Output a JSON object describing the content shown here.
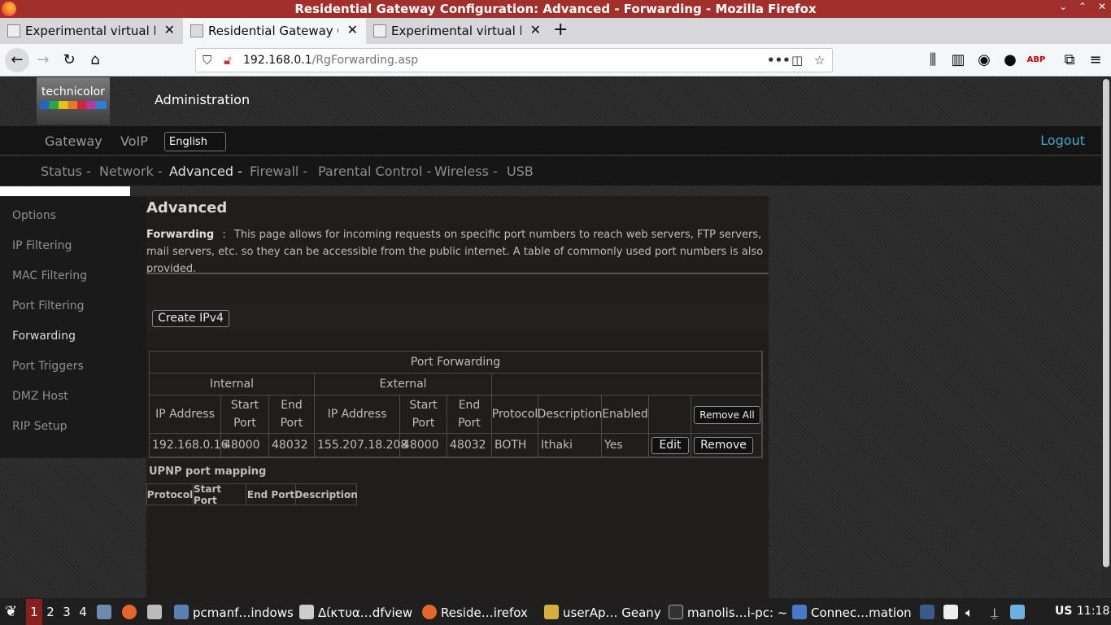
{
  "window": {
    "title": "Residential Gateway Configuration: Advanced - Forwarding - Mozilla Firefox",
    "buttons": [
      "⌄",
      "⌃",
      "✕"
    ]
  },
  "tabs": [
    {
      "label": "Experimental virtual lab"
    },
    {
      "label": "Residential Gateway Con"
    },
    {
      "label": "Experimental virtual lab"
    }
  ],
  "browser": {
    "url_host": "192.168.0.1",
    "url_path": "/RgForwarding.asp",
    "more_icon": "•••"
  },
  "router": {
    "brand": "technicolor",
    "header_title": "Administration",
    "topnav": [
      "Gateway",
      "VoIP"
    ],
    "language": "English",
    "logout": "Logout",
    "subnav": [
      "Status -",
      "Network -",
      "Advanced -",
      "Firewall -",
      "Parental Control -",
      "Wireless -",
      "USB"
    ],
    "sidebar": [
      "Options",
      "IP Filtering",
      "MAC Filtering",
      "Port Filtering",
      "Forwarding",
      "Port Triggers",
      "DMZ Host",
      "RIP Setup"
    ],
    "page_heading": "Advanced",
    "desc_label": "Forwarding",
    "desc_sep": ":",
    "desc_text": "This page allows for incoming requests on specific port numbers to reach web servers, FTP servers, mail servers, etc. so they can be accessible from the public internet. A table of commonly used port numbers is also provided.",
    "create_button": "Create IPv4",
    "port_forwarding": {
      "title": "Port Forwarding",
      "group_internal": "Internal",
      "group_external": "External",
      "headers": [
        "IP Address",
        "Start Port",
        "End Port",
        "IP Address",
        "Start Port",
        "End Port",
        "Protocol",
        "Description",
        "Enabled"
      ],
      "remove_all": "Remove All",
      "rows": [
        {
          "int_ip": "192.168.0.16",
          "int_start": "48000",
          "int_end": "48032",
          "ext_ip": "155.207.18.208",
          "ext_start": "48000",
          "ext_end": "48032",
          "protocol": "BOTH",
          "description": "Ithaki",
          "enabled": "Yes",
          "edit": "Edit",
          "remove": "Remove"
        }
      ]
    },
    "upnp": {
      "title": "UPNP port mapping",
      "headers": [
        "Protocol",
        "Start Port",
        "End Port",
        "Description"
      ]
    }
  },
  "taskbar": {
    "workspaces": [
      "1",
      "2",
      "3",
      "4"
    ],
    "items": [
      "pcmanf…indows",
      "Δίκτυα…dfview",
      "Reside…irefox",
      "userAp… Geany",
      "manolis…i-pc: ~",
      "Connec…mation"
    ],
    "keyboard": "US",
    "clock": "11:18"
  }
}
